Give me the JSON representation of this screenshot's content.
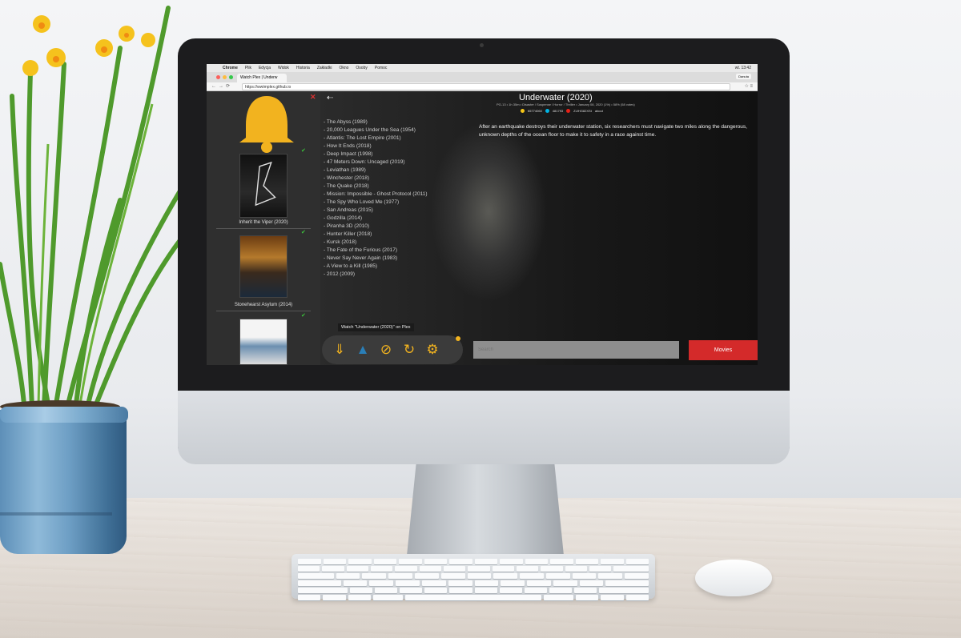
{
  "browser": {
    "menu": [
      "Chrome",
      "Plik",
      "Edycja",
      "Widok",
      "Historia",
      "Zakładki",
      "Okno",
      "Osoby",
      "Pomoc"
    ],
    "clock": "wt. 13:42",
    "tab_title": "Watch Plex | Underw",
    "profile": "Danuta",
    "url": "https://wwtmplex.github.io"
  },
  "sidebar": {
    "posters": [
      {
        "title": "Inherit the Viper (2020)"
      },
      {
        "title": "Stonehearst Asylum (2014)"
      },
      {
        "title": ""
      }
    ]
  },
  "movie": {
    "title": "Underwater (2020)",
    "meta": "PG-13 • 1h 35m • Disaster / Suspense / Horror / Thriller • January 08, 2020 (1%) • 58% (58 votes)",
    "ratings": [
      "tt5774060",
      "481793",
      "ZLfHG82XSt",
      "about"
    ],
    "description": "After an earthquake destroys their underwater station, six researchers must navigate two miles along the dangerous, unknown depths of the ocean floor to make it to safety in a race against time."
  },
  "related": [
    "- The Abyss (1989)",
    "- 20,000 Leagues Under the Sea (1954)",
    "- Atlantis: The Lost Empire (2001)",
    "- How It Ends (2018)",
    "- Deep Impact (1998)",
    "- 47 Meters Down: Uncaged (2019)",
    "- Leviathan (1989)",
    "- Winchester (2018)",
    "- The Quake (2018)",
    "- Mission: Impossible - Ghost Protocol (2011)",
    "- The Spy Who Loved Me (1977)",
    "- San Andreas (2015)",
    "- Godzilla (2014)",
    "- Piranha 3D (2010)",
    "- Hunter Killer (2018)",
    "- Kursk (2018)",
    "- The Fate of the Furious (2017)",
    "- Never Say Never Again (1983)",
    "- A View to a Kill (1985)",
    "- 2012 (2009)"
  ],
  "toolbar": {
    "tooltip": "Watch \"Underwater (2020)\" on Plex",
    "icons": [
      "download-icon",
      "plex-icon",
      "hide-icon",
      "refresh-icon",
      "settings-icon"
    ]
  },
  "search": {
    "placeholder": "Search"
  },
  "movies_button": "Movies",
  "colors": {
    "accent": "#f2b31f",
    "movies_button": "#d42a2a",
    "check": "#3bc23b"
  }
}
